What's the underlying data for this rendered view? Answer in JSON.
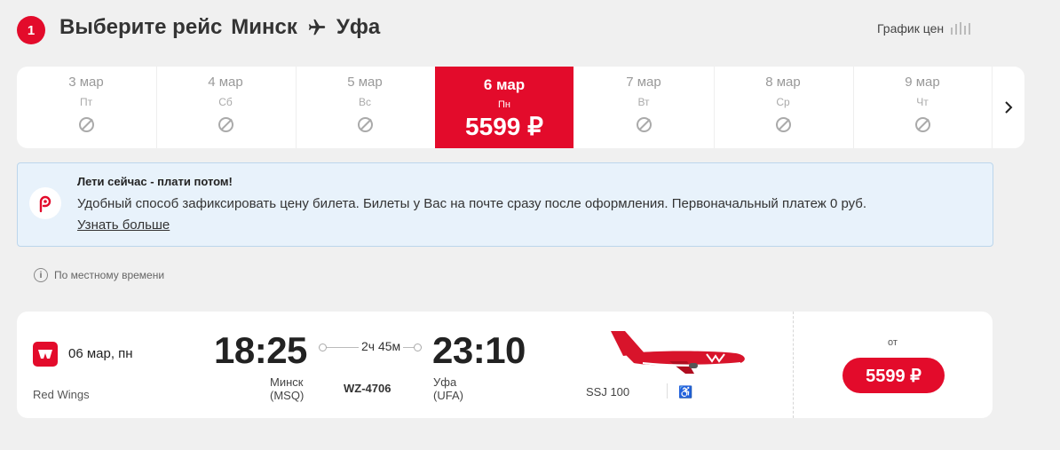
{
  "header": {
    "step": "1",
    "title_prefix": "Выберите рейс",
    "from": "Минск",
    "to": "Уфа",
    "price_graph": "График цен"
  },
  "dates": [
    {
      "date": "3 мар",
      "weekday": "Пт",
      "price": null,
      "available": false
    },
    {
      "date": "4 мар",
      "weekday": "Сб",
      "price": null,
      "available": false
    },
    {
      "date": "5 мар",
      "weekday": "Вс",
      "price": null,
      "available": false
    },
    {
      "date": "6 мар",
      "weekday": "Пн",
      "price": "5599 ₽",
      "available": true,
      "selected": true
    },
    {
      "date": "7 мар",
      "weekday": "Вт",
      "price": null,
      "available": false
    },
    {
      "date": "8 мар",
      "weekday": "Ср",
      "price": null,
      "available": false
    },
    {
      "date": "9 мар",
      "weekday": "Чт",
      "price": null,
      "available": false
    }
  ],
  "banner": {
    "heading": "Лети сейчас - плати потом!",
    "text": "Удобный способ зафиксировать цену билета. Билеты у Вас на почте сразу после оформления. Первоначальный платеж 0 руб.",
    "link": "Узнать больше"
  },
  "local_time_note": "По местному времени",
  "flight": {
    "date": "06 мар, пн",
    "airline": "Red Wings",
    "dep_time": "18:25",
    "dep_city": "Минск",
    "dep_code": "(MSQ)",
    "duration": "2ч 45м",
    "flight_no": "WZ-4706",
    "arr_time": "23:10",
    "arr_city": "Уфа",
    "arr_code": "(UFA)",
    "aircraft": "SSJ 100",
    "price_from": "от",
    "price": "5599 ₽"
  },
  "colors": {
    "accent": "#e30b2b",
    "banner_bg": "#e8f2fb"
  }
}
